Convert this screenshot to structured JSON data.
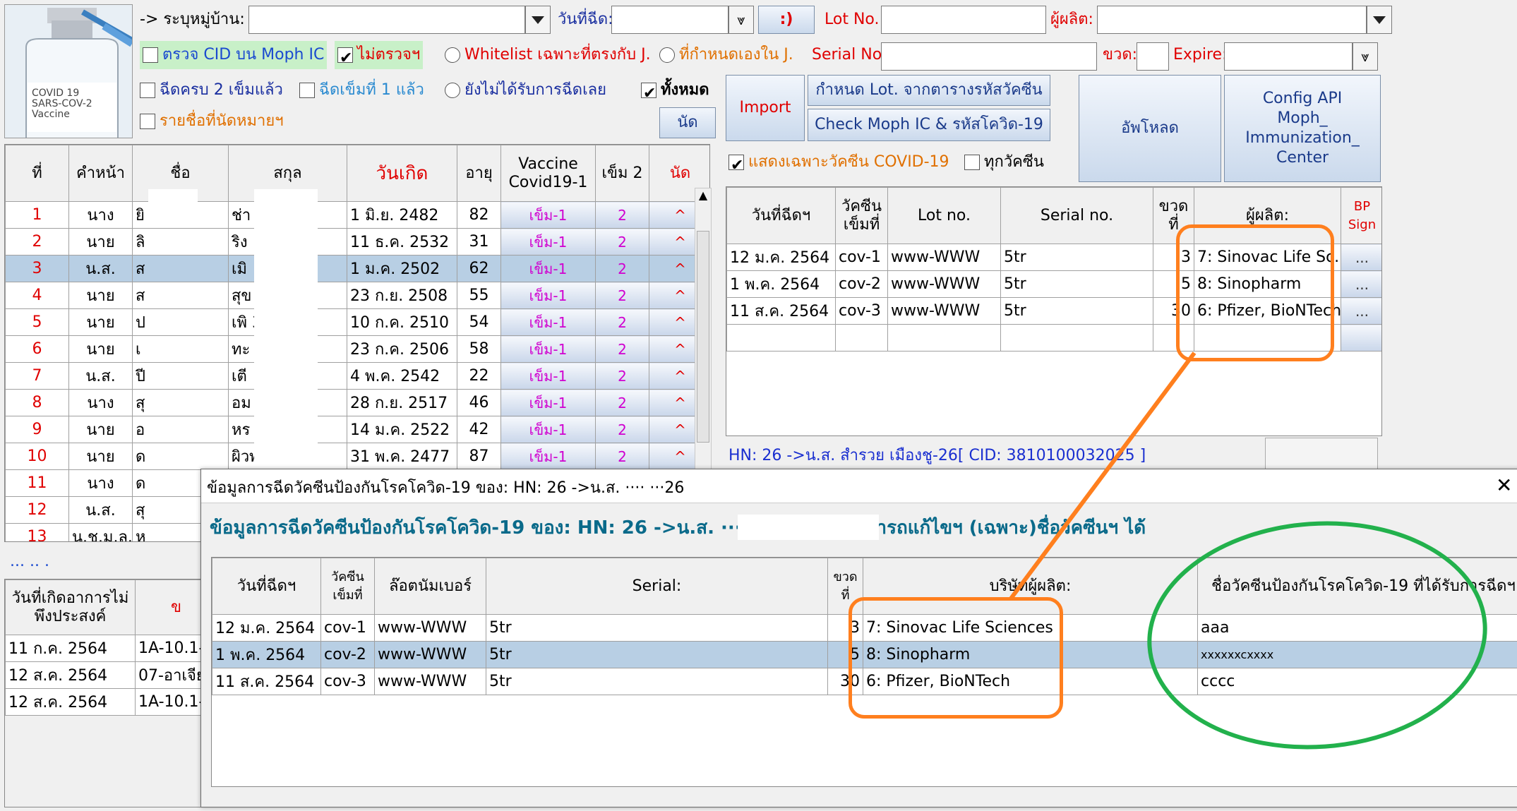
{
  "toolbar": {
    "village_label": "-> ระบุหมู่บ้าน:",
    "village_value": "",
    "date_label": "วันที่ฉีด:",
    "date_value": "",
    "smiley_label": ":)",
    "lot_label": "Lot No.",
    "lot_value": "",
    "producer_label": "ผู้ผลิต:",
    "producer_value": "",
    "serial_label": "Serial No.",
    "serial_value": "",
    "bottle_label": "ขวด:",
    "bottle_value": "",
    "expire_label": "Expire:",
    "expire_value": ""
  },
  "filters": {
    "check_cid": "ตรวจ CID บน Moph IC",
    "no_check": "ไม่ตรวจฯ",
    "whitelist": "Whitelist เฉพาะที่ตรงกับ J.",
    "custom_j": "ที่กำหนดเองใน J.",
    "full2": "ฉีดครบ 2 เข็มแล้ว",
    "dose1": "ฉีดเข็มที่ 1 แล้ว",
    "none": "ยังไม่ได้รับการฉีดเลย",
    "all": "ทั้งหมด",
    "appointments": "รายชื่อที่นัดหมายฯ",
    "appoint_btn": "นัด",
    "show_covid": "แสดงเฉพาะวัคซีน COVID-19",
    "all_vaccines": "ทุกวัคซีน"
  },
  "buttons": {
    "import": "Import",
    "set_lot": "กำหนด Lot. จากตารางรหัสวัคซีน",
    "check_moph": "Check Moph IC & รหัสโควิด-19",
    "upload": "อัพโหลด",
    "config_api": "Config API Moph_ Immunization_ Center"
  },
  "vial_image": {
    "text": "COVID 19 SARS-COV-2 Vaccine"
  },
  "patients": {
    "headers": [
      "ที่",
      "คำหน้า",
      "ชื่อ",
      "สกุล",
      "วันเกิด",
      "อายุ",
      "Vaccine Covid19-1",
      "เข็ม 2",
      "นัด"
    ],
    "rows": [
      {
        "no": "1",
        "prefix": "นาง",
        "name": "ยิ",
        "surname": "ช่า",
        "dob": "1 มิ.ย. 2482",
        "age": "82",
        "v1": "เข็ม-1",
        "v2": "2",
        "ap": "^"
      },
      {
        "no": "2",
        "prefix": "นาย",
        "name": "ลิ",
        "surname": "ริง",
        "dob": "11 ธ.ค. 2532",
        "age": "31",
        "v1": "เข็ม-1",
        "v2": "2",
        "ap": "^"
      },
      {
        "no": "3",
        "prefix": "น.ส.",
        "name": "ส",
        "surname": "เมิ",
        "dob": "1 ม.ค. 2502",
        "age": "62",
        "v1": "เข็ม-1",
        "v2": "2",
        "ap": "^"
      },
      {
        "no": "4",
        "prefix": "นาย",
        "name": "ส",
        "surname": "สุข",
        "dob": "23 ก.ย. 2508",
        "age": "55",
        "v1": "เข็ม-1",
        "v2": "2",
        "ap": "^"
      },
      {
        "no": "5",
        "prefix": "นาย",
        "name": "ป",
        "surname": "เพิ 31",
        "dob": "10 ก.ค. 2510",
        "age": "54",
        "v1": "เข็ม-1",
        "v2": "2",
        "ap": "^"
      },
      {
        "no": "6",
        "prefix": "นาย",
        "name": "เ",
        "surname": "ทะ",
        "dob": "23 ก.ค. 2506",
        "age": "58",
        "v1": "เข็ม-1",
        "v2": "2",
        "ap": "^"
      },
      {
        "no": "7",
        "prefix": "น.ส.",
        "name": "ปี",
        "surname": "เตี",
        "dob": "4 พ.ค. 2542",
        "age": "22",
        "v1": "เข็ม-1",
        "v2": "2",
        "ap": "^"
      },
      {
        "no": "8",
        "prefix": "นาง",
        "name": "สุ",
        "surname": "อม 05",
        "dob": "28 ก.ย. 2517",
        "age": "46",
        "v1": "เข็ม-1",
        "v2": "2",
        "ap": "^"
      },
      {
        "no": "9",
        "prefix": "นาย",
        "name": "อ",
        "surname": "หร",
        "dob": "14 ม.ค. 2522",
        "age": "42",
        "v1": "เข็ม-1",
        "v2": "2",
        "ap": "^"
      },
      {
        "no": "10",
        "prefix": "นาย",
        "name": "ด",
        "surname": "ผิวพ-1025",
        "dob": "31 พ.ค. 2477",
        "age": "87",
        "v1": "เข็ม-1",
        "v2": "2",
        "ap": "^"
      },
      {
        "no": "11",
        "prefix": "นาง",
        "name": "ด",
        "surname": "",
        "dob": "",
        "age": "",
        "v1": "",
        "v2": "",
        "ap": ""
      },
      {
        "no": "12",
        "prefix": "น.ส.",
        "name": "สุ",
        "surname": "",
        "dob": "",
        "age": "",
        "v1": "",
        "v2": "",
        "ap": ""
      },
      {
        "no": "13",
        "prefix": "น.ช.ม.ล.",
        "name": "ห",
        "surname": "",
        "dob": "",
        "age": "",
        "v1": "",
        "v2": "",
        "ap": ""
      }
    ]
  },
  "ellipsis": "... .. .",
  "adverse": {
    "header1": "วันที่เกิดอาการไม่พึงประสงค์",
    "header2": "ข",
    "rows": [
      {
        "date": "11 ก.ค. 2564",
        "code": "1A-10.1-"
      },
      {
        "date": "12 ส.ค. 2564",
        "code": "07-อาเจีย"
      },
      {
        "date": "12 ส.ค. 2564",
        "code": "1A-10.1-"
      }
    ]
  },
  "vaccinations": {
    "headers": [
      "วันที่ฉีดฯ",
      "วัคซีนเข็มที่",
      "Lot no.",
      "Serial no.",
      "ขวดที่",
      "ผู้ผลิต:",
      "BP Sign"
    ],
    "rows": [
      {
        "date": "12 ม.ค. 2564",
        "dose": "cov-1",
        "lot": "www-WWW",
        "serial": "5tr",
        "bottle": "3",
        "maker": "7: Sinovac Life Sc...",
        "btn": "..."
      },
      {
        "date": "1 พ.ค. 2564",
        "dose": "cov-2",
        "lot": "www-WWW",
        "serial": "5tr",
        "bottle": "5",
        "maker": "8: Sinopharm",
        "btn": "..."
      },
      {
        "date": "11 ส.ค. 2564",
        "dose": "cov-3",
        "lot": "www-WWW",
        "serial": "5tr",
        "bottle": "30",
        "maker": "6: Pfizer, BioNTech",
        "btn": "..."
      }
    ]
  },
  "status_line": "HN: 26 ->น.ส. สำรวย เมืองชู-26[ CID: 3810100032025 ]",
  "dialog": {
    "title": "ข้อมูลการฉีดวัคซีนป้องกันโรคโควิด-19 ของ: HN: 26 ->น.ส. ···· ···26",
    "heading": "ข้อมูลการฉีดวัคซีนป้องกันโรคโควิด-19 ของ: HN: 26 ->น.ส. ··· ···· ..โดย..สามารถแก้ไขฯ (เฉพาะ)ชื่อวัคซีนฯ ได้",
    "close": "✕",
    "headers": [
      "วันที่ฉีดฯ",
      "วัคซีนเข็มที่",
      "ล๊อตนัมเบอร์",
      "Serial:",
      "ขวดที่",
      "บริษัทผู้ผลิต:",
      "ชื่อวัคซีนป้องกันโรคโควิด-19 ที่ได้รับการฉีดฯ"
    ],
    "rows": [
      {
        "date": "12 ม.ค. 2564",
        "dose": "cov-1",
        "lot": "www-WWW",
        "serial": "5tr",
        "bottle": "3",
        "maker": "7: Sinovac Life Sciences",
        "name": "aaa"
      },
      {
        "date": "1 พ.ค. 2564",
        "dose": "cov-2",
        "lot": "www-WWW",
        "serial": "5tr",
        "bottle": "5",
        "maker": "8: Sinopharm",
        "name": "xxxxxxcxxxx"
      },
      {
        "date": "11 ส.ค. 2564",
        "dose": "cov-3",
        "lot": "www-WWW",
        "serial": "5tr",
        "bottle": "30",
        "maker": "6: Pfizer, BioNTech",
        "name": "cccc"
      }
    ]
  },
  "colors": {
    "annotation_orange": "#ff7f1e",
    "annotation_green": "#22b14c",
    "selection": "#b8cfe4",
    "accent_red": "#e00000"
  }
}
